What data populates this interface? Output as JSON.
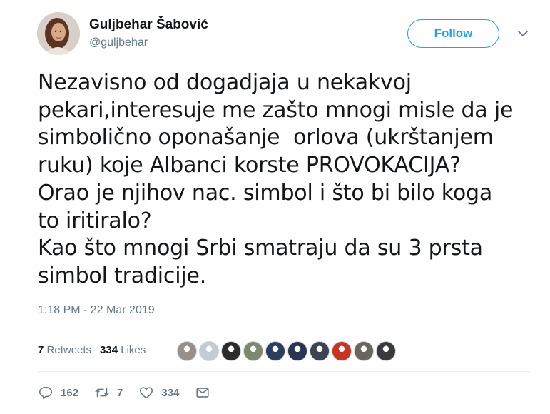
{
  "author": {
    "name": "Guljbehar Šabović",
    "handle": "@guljbehar"
  },
  "follow_label": "Follow",
  "tweet_text": "Nezavisno od dogadjaja u nekakvoj\npekari,interesuje me zašto mnogi misle da je\nsimbolično oponašanje  orlova (ukrštanjem\nruku) koje Albanci korste PROVOKACIJA?\nOrao je njihov nac. simbol i što bi bilo koga\nto iritiralo?\nKao što mnogi Srbi smatraju da su 3 prsta\nsimbol tradicije.",
  "timestamp": "1:18 PM - 22 Mar 2019",
  "stats": {
    "retweets_count": "7",
    "retweets_label": "Retweets",
    "likes_count": "334",
    "likes_label": "Likes"
  },
  "liker_avatar_colors": [
    "#9a8f88",
    "#c4ccd3",
    "#2c2c2c",
    "#7a8a6a",
    "#2d3e5c",
    "#2a3550",
    "#3b4250",
    "#c8341e",
    "#6b6560",
    "#3a3a3a"
  ],
  "actions": {
    "reply_count": "162",
    "retweet_count": "7",
    "like_count": "334"
  },
  "colors": {
    "brand": "#1da1f2",
    "secondary_text": "#657786"
  }
}
